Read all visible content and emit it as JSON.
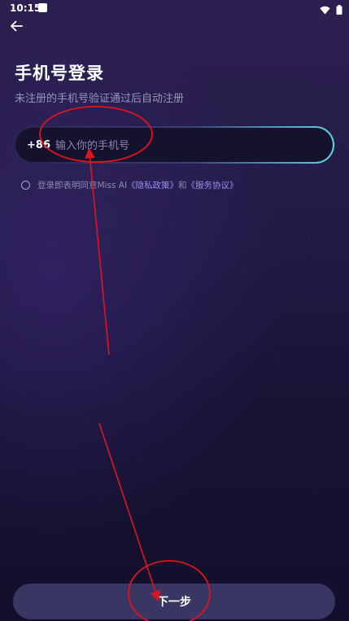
{
  "status_bar": {
    "time": "10:15",
    "icons": [
      "app-notification-icon",
      "wifi-icon",
      "battery-icon"
    ]
  },
  "header": {
    "back_icon": "arrow-left-icon"
  },
  "main": {
    "title": "手机号登录",
    "subtitle": "未注册的手机号验证通过后自动注册",
    "phone": {
      "country_code": "+86",
      "placeholder": "输入你的手机号",
      "value": ""
    },
    "agreement": {
      "checked": false,
      "prefix": "登录即表明同意Miss AI",
      "privacy_link": "《隐私政策》",
      "conjunction": "和",
      "service_link": "《服务协议》"
    }
  },
  "footer": {
    "next_label": "下一步"
  },
  "colors": {
    "background_top": "#2c2050",
    "background_bottom": "#120f2b",
    "input_border_accent": "#5fd6e6",
    "link": "#9b8cf0",
    "button_bg": "#3a3663",
    "annotation_red": "#e0141e"
  }
}
